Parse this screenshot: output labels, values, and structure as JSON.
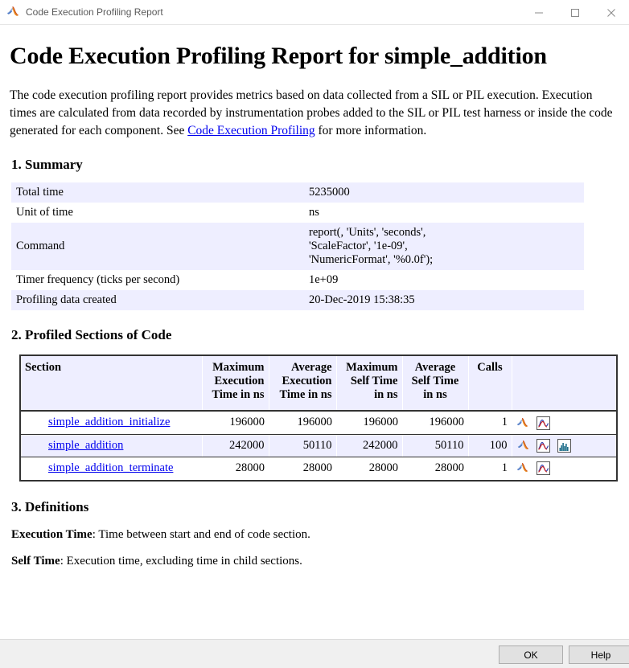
{
  "window": {
    "title": "Code Execution Profiling Report",
    "app_icon": "matlab-membrane-icon",
    "controls": {
      "minimize": "minimize-icon",
      "maximize": "maximize-icon",
      "close": "close-icon"
    }
  },
  "report": {
    "title": "Code Execution Profiling Report for simple_addition",
    "intro_part1": "The code execution profiling report provides metrics based on data collected from a SIL or PIL execution. Execution times are calculated from data recorded by instrumentation probes added to the SIL or PIL test harness or inside the code generated for each component. See ",
    "intro_link": "Code Execution Profiling",
    "intro_part2": " for more information."
  },
  "summary": {
    "heading": "1. Summary",
    "rows": [
      {
        "key": "Total time",
        "value": "5235000"
      },
      {
        "key": "Unit of time",
        "value": "ns"
      },
      {
        "key": "Command",
        "value": "report(, 'Units', 'seconds', 'ScaleFactor', '1e-09', 'NumericFormat', '%0.0f');"
      },
      {
        "key": "Timer frequency (ticks per second)",
        "value": "1e+09"
      },
      {
        "key": "Profiling data created",
        "value": "20-Dec-2019 15:38:35"
      }
    ]
  },
  "profiled": {
    "heading": "2. Profiled Sections of Code",
    "columns": [
      "Section",
      "Maximum Execution Time in ns",
      "Average Execution Time in ns",
      "Maximum Self Time in ns",
      "Average Self Time in ns",
      "Calls",
      ""
    ],
    "rows": [
      {
        "section": "simple_addition_initialize",
        "max_exec": "196000",
        "avg_exec": "196000",
        "max_self": "196000",
        "avg_self": "196000",
        "calls": "1",
        "icons": [
          "matlab-membrane-icon",
          "plot-curve-icon"
        ]
      },
      {
        "section": "simple_addition",
        "max_exec": "242000",
        "avg_exec": "50110",
        "max_self": "242000",
        "avg_self": "50110",
        "calls": "100",
        "icons": [
          "matlab-membrane-icon",
          "plot-curve-icon",
          "histogram-icon"
        ]
      },
      {
        "section": "simple_addition_terminate",
        "max_exec": "28000",
        "avg_exec": "28000",
        "max_self": "28000",
        "avg_self": "28000",
        "calls": "1",
        "icons": [
          "matlab-membrane-icon",
          "plot-curve-icon"
        ]
      }
    ]
  },
  "definitions": {
    "heading": "3. Definitions",
    "items": [
      {
        "term": "Execution Time",
        "text": ": Time between start and end of code section."
      },
      {
        "term": "Self Time",
        "text": ": Execution time, excluding time in child sections."
      }
    ]
  },
  "footer": {
    "ok_label": "OK",
    "help_label": "Help"
  },
  "colors": {
    "band": "#eeeeff",
    "link": "#0000ee",
    "table_border": "#333333",
    "footer_bg": "#f0f0f0"
  }
}
